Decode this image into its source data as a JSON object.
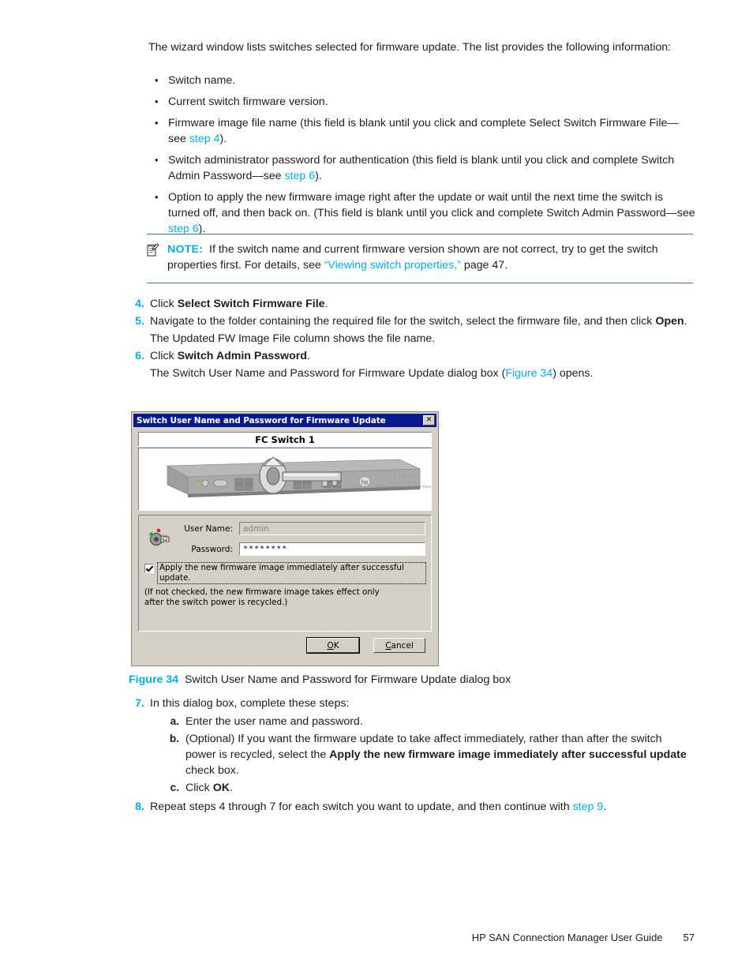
{
  "colors": {
    "link": "#00aeef",
    "accent": "#00aeef",
    "note_rule": "#3b7a8c",
    "dialog_titlebar": "#0a1a8c",
    "dialog_face": "#d4d0c8"
  },
  "intro": {
    "paragraph": "The wizard window lists switches selected for firmware update. The list provides the following information:"
  },
  "bullets": [
    {
      "marker": "•",
      "text": "Switch name."
    },
    {
      "marker": "•",
      "text": "Current switch firmware version."
    },
    {
      "marker": "•",
      "pre": "Firmware image file name (this field is blank until you click and complete Select Switch Firmware File—see ",
      "link": "step 4",
      "post": ")."
    },
    {
      "marker": "•",
      "pre": "Switch administrator password for authentication (this field is blank until you click and complete Switch Admin Password—see ",
      "link": "step 6",
      "post": ")."
    },
    {
      "marker": "•",
      "pre": "Option to apply the new firmware image right after the update or wait until the next time the switch is turned off, and then back on. (This field is blank until you click and complete Switch Admin Password—see ",
      "link": "step 6",
      "post": ")."
    }
  ],
  "note": {
    "icon": "note-pencil-icon",
    "label": "NOTE:",
    "text_before": "If the switch name and current firmware version shown are not correct, try to get the switch properties first. For details, see ",
    "link": "“Viewing switch properties,”",
    "text_after": " page 47."
  },
  "steps": {
    "step4": {
      "num": "4.",
      "pre": "Click ",
      "bold": "Select Switch Firmware File",
      "post": "."
    },
    "step5": {
      "num": "5.",
      "pre": "Navigate to the folder containing the required file for the switch, select the firmware file, and then click ",
      "bold": "Open",
      "post": ".",
      "continuation": "The Updated FW Image File column shows the file name."
    },
    "step6": {
      "num": "6.",
      "pre": "Click ",
      "bold": "Switch Admin Password",
      "post": ".",
      "cont_pre": "The Switch User Name and Password for Firmware Update dialog box (",
      "cont_link": "Figure 34",
      "cont_post": ") opens."
    },
    "step7": {
      "num": "7.",
      "text": "In this dialog box, complete these steps:",
      "substeps": [
        {
          "letter": "a.",
          "pre": "Enter the user name and password.",
          "bold": "",
          "post": ""
        },
        {
          "letter": "b.",
          "pre": "(Optional) If you want the firmware update to take affect immediately, rather than after the switch power is recycled, select the ",
          "bold": "Apply the new firmware image immediately after successful update",
          "post": " check box."
        },
        {
          "letter": "c.",
          "pre": "Click ",
          "bold": "OK",
          "post": "."
        }
      ]
    },
    "step8": {
      "num": "8.",
      "pre": "Repeat steps 4 through 7 for each switch you want to update, and then continue with ",
      "link": "step 9",
      "post": "."
    }
  },
  "dialog": {
    "title": "Switch User Name and Password for Firmware Update",
    "close_glyph": "✕",
    "switch_name": "FC Switch 1",
    "switch_image_alt": "fc-switch-with-key-illustration",
    "fields": [
      {
        "label": "User Name:",
        "value": "admin",
        "disabled": true
      },
      {
        "label": "Password:",
        "value": "********",
        "disabled": false
      }
    ],
    "checkbox": {
      "checked": true,
      "label": "Apply the new firmware image immediately after successful update."
    },
    "checkbox_note": "(If not checked, the new firmware image takes effect only after the switch power is recycled.)",
    "buttons": [
      {
        "label": "OK",
        "mnemonic": "O",
        "rest": "K",
        "default": true
      },
      {
        "label": "Cancel",
        "mnemonic": "C",
        "rest": "ancel",
        "default": false
      }
    ]
  },
  "figure": {
    "label": "Figure 34",
    "caption": "Switch User Name and Password for Firmware Update dialog box"
  },
  "footer": {
    "guide": "HP SAN Connection Manager User Guide",
    "page": "57"
  }
}
